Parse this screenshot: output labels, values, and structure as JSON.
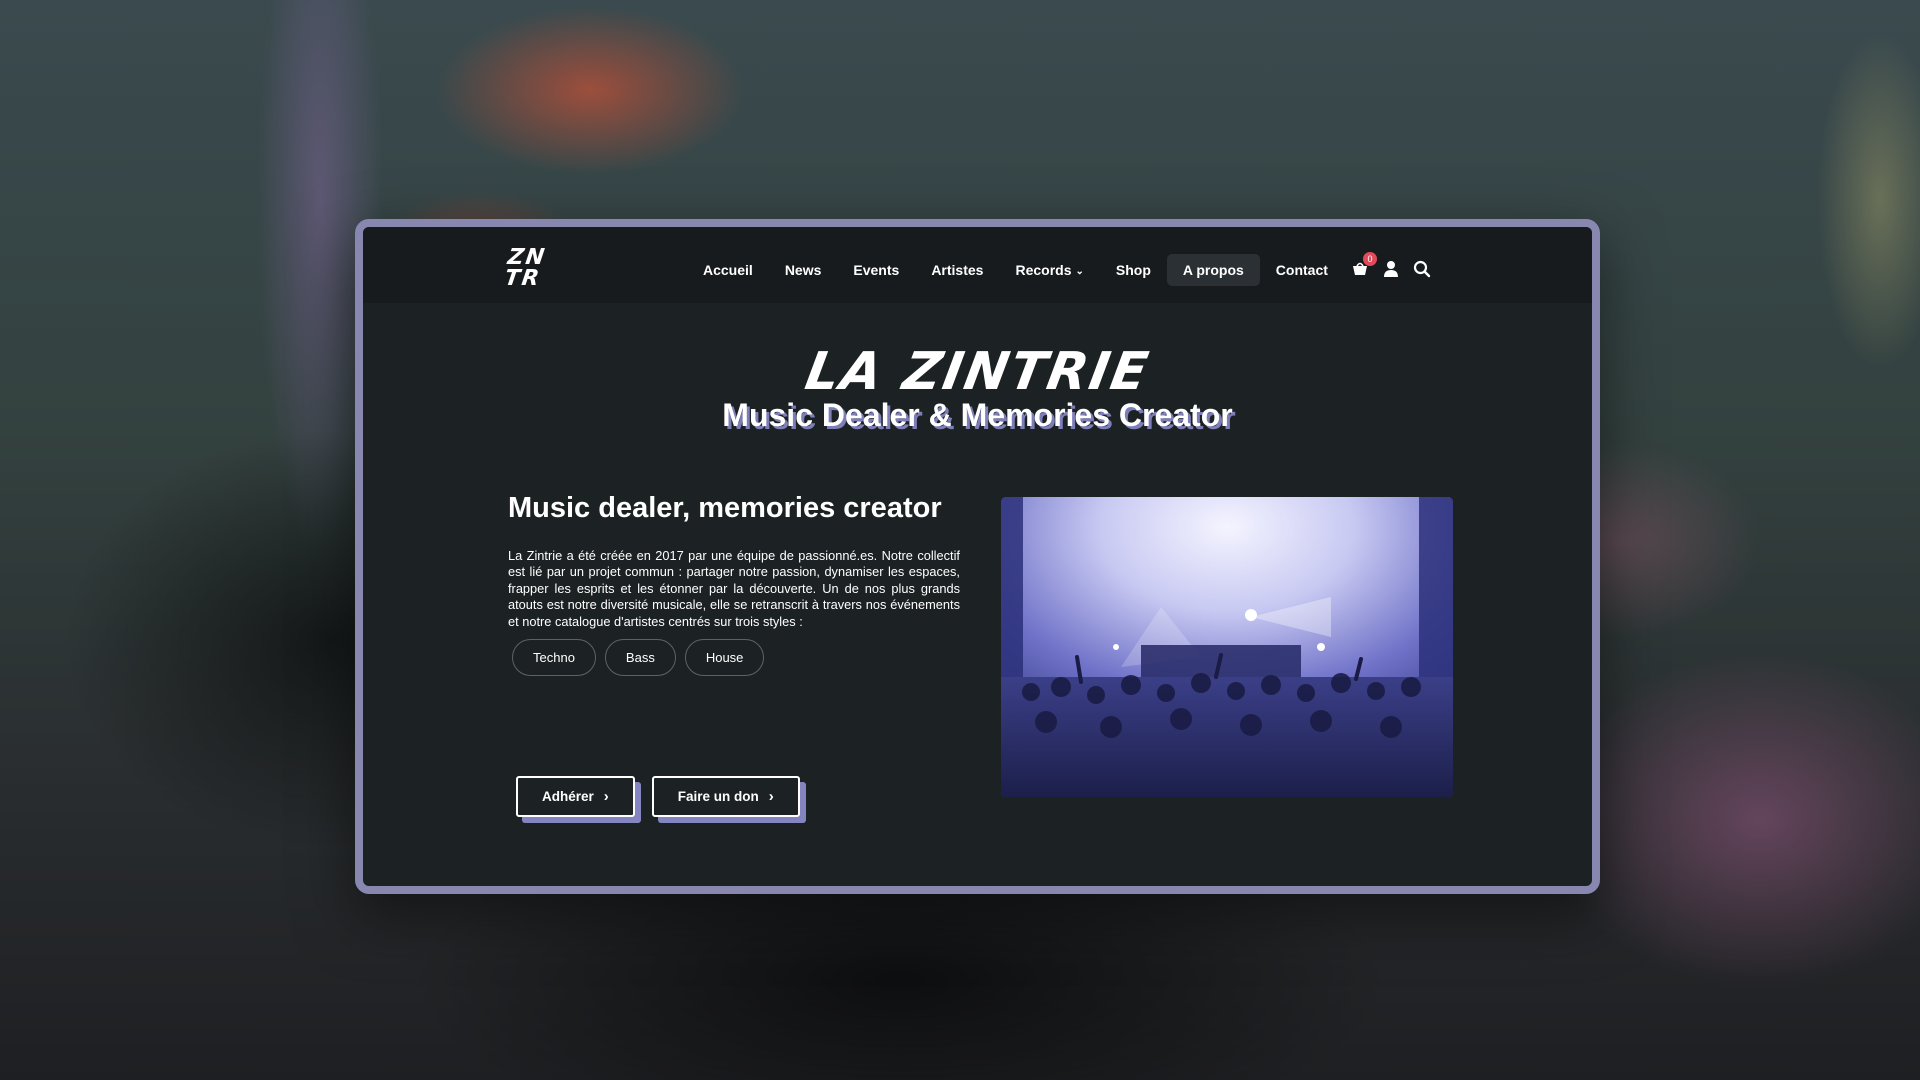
{
  "brand": {
    "logo_text": "ZN TR"
  },
  "nav": {
    "items": [
      {
        "label": "Accueil",
        "active": false
      },
      {
        "label": "News",
        "active": false
      },
      {
        "label": "Events",
        "active": false
      },
      {
        "label": "Artistes",
        "active": false
      },
      {
        "label": "Records",
        "active": false,
        "has_dropdown": true
      },
      {
        "label": "Shop",
        "active": false
      },
      {
        "label": "A propos",
        "active": true
      },
      {
        "label": "Contact",
        "active": false
      }
    ],
    "dropdown_chevron": "⌄",
    "cart_count": "0",
    "icons": [
      "cart-icon",
      "user-icon",
      "search-icon"
    ]
  },
  "hero": {
    "title": "LA ZINTRIE",
    "subtitle": "Music Dealer & Memories Creator"
  },
  "about": {
    "heading": "Music dealer, memories creator",
    "body": "La Zintrie a été créée en 2017 par une équipe de passionné.es. Notre collectif est lié par un projet commun : partager notre passion, dynamiser les espaces, frapper les esprits et les étonner par la découverte. Un de nos plus grands atouts est notre diversité musicale, elle se retranscrit à travers nos événements et notre catalogue d'artistes centrés sur trois styles :",
    "styles": [
      "Techno",
      "Bass",
      "House"
    ]
  },
  "cta": {
    "join_label": "Adhérer",
    "donate_label": "Faire un don",
    "chevron": "›"
  },
  "colors": {
    "accent": "#8787b0",
    "background": "#1c2123",
    "badge": "#e04a5a"
  }
}
